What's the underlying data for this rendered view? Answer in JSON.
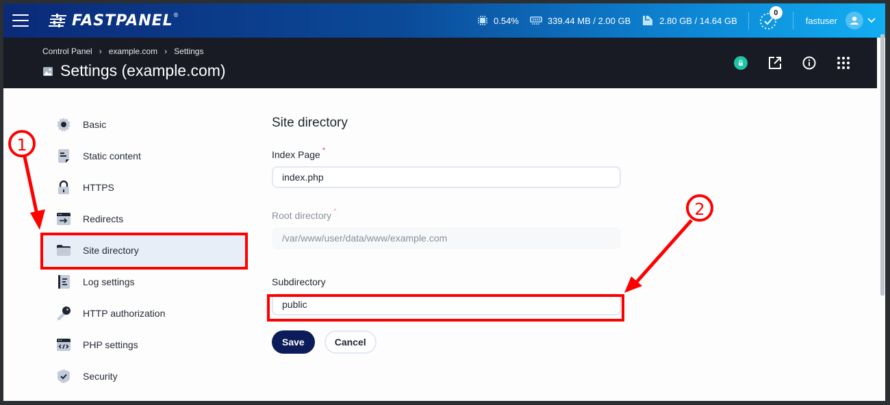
{
  "topbar": {
    "menu_icon": "hamburger-icon",
    "brand": "FASTPANEL",
    "brand_reg": "®",
    "cpu": "0.54%",
    "ram": "339.44 MB / 2.00 GB",
    "disk": "2.80 GB / 14.64 GB",
    "tasks_count": "0",
    "username": "fastuser"
  },
  "header": {
    "breadcrumb": [
      "Control Panel",
      "example.com",
      "Settings"
    ],
    "breadcrumb_sep": "›",
    "title": "Settings (example.com)",
    "actions": [
      "ssl-lock-icon",
      "external-link-icon",
      "info-icon",
      "apps-grid-icon"
    ]
  },
  "sidebar": {
    "items": [
      {
        "label": "Basic",
        "icon": "gear-icon"
      },
      {
        "label": "Static content",
        "icon": "document-icon"
      },
      {
        "label": "HTTPS",
        "icon": "lock-icon"
      },
      {
        "label": "Redirects",
        "icon": "redirect-icon"
      },
      {
        "label": "Site directory",
        "icon": "folder-icon",
        "active": true
      },
      {
        "label": "Log settings",
        "icon": "log-icon"
      },
      {
        "label": "HTTP authorization",
        "icon": "key-icon"
      },
      {
        "label": "PHP settings",
        "icon": "code-icon"
      },
      {
        "label": "Security",
        "icon": "shield-check-icon"
      }
    ]
  },
  "form": {
    "title": "Site directory",
    "index_page": {
      "label": "Index Page",
      "required": "*",
      "value": "index.php"
    },
    "root_directory": {
      "label": "Root directory",
      "required": "*",
      "value": "/var/www/user/data/www/example.com",
      "disabled": true
    },
    "subdirectory": {
      "label": "Subdirectory",
      "value": "public"
    },
    "save_label": "Save",
    "cancel_label": "Cancel"
  },
  "annotations": {
    "step1": "1",
    "step2": "2",
    "color": "#ff0000"
  },
  "colors": {
    "topbar_start": "#0b2a78",
    "topbar_end": "#12aef2",
    "header_bg": "#181b23",
    "save_button": "#0c1c5a",
    "ssl_badge": "#20c2a8",
    "active_nav_bg": "#e8eef7",
    "required_star": "#e53950"
  }
}
